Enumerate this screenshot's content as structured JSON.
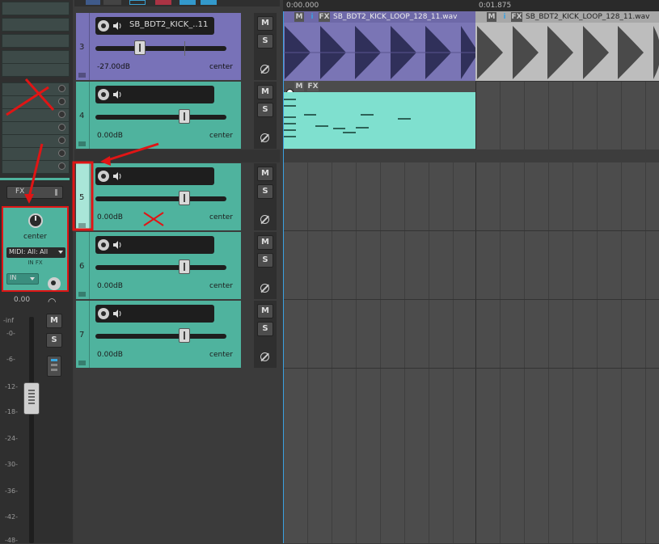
{
  "mixer": {
    "fx_label": "FX",
    "pan_label": "center",
    "midi_input": "MIDI: All: All",
    "in_fx_label": "IN FX",
    "in_label": "IN",
    "volume_readout": "0.00",
    "m_label": "M",
    "s_label": "S",
    "meter_scale": [
      "-inf",
      "-0-",
      "-6-",
      "-12-",
      "-18-",
      "-24-",
      "-30-",
      "-36-",
      "-42-",
      "-48-"
    ]
  },
  "tracks": [
    {
      "number": "3",
      "name": "SB_BDT2_KICK_..11",
      "volume": "-27.00dB",
      "pan": "center",
      "fader_level": 0.34,
      "color": "#7872b8"
    },
    {
      "number": "4",
      "name": "",
      "volume": "0.00dB",
      "pan": "center",
      "fader_level": 0.68,
      "color": "#4fb39e"
    },
    {
      "number": "5",
      "name": "",
      "volume": "0.00dB",
      "pan": "center",
      "fader_level": 0.68,
      "color": "#4fb39e"
    },
    {
      "number": "6",
      "name": "",
      "volume": "0.00dB",
      "pan": "center",
      "fader_level": 0.68,
      "color": "#4fb39e"
    },
    {
      "number": "7",
      "name": "",
      "volume": "0.00dB",
      "pan": "center",
      "fader_level": 0.68,
      "color": "#4fb39e"
    }
  ],
  "track_buttons": {
    "mute": "M",
    "solo": "S"
  },
  "ruler": {
    "markers": [
      "0:00.000",
      "0:01.875"
    ]
  },
  "items": [
    {
      "label": "SB_BDT2_KICK_LOOP_128_11.wav",
      "kind": "audio",
      "selected": true
    },
    {
      "label": "SB_BDT2_KICK_LOOP_128_11.wav",
      "kind": "audio",
      "selected": false
    }
  ],
  "item_buttons": {
    "m": "M",
    "i": "i",
    "fx": "FX"
  },
  "colors": {
    "accent_red": "#e01515",
    "teal": "#4fb39e",
    "purple": "#7872b8",
    "midi_item": "#7fe0cf"
  }
}
